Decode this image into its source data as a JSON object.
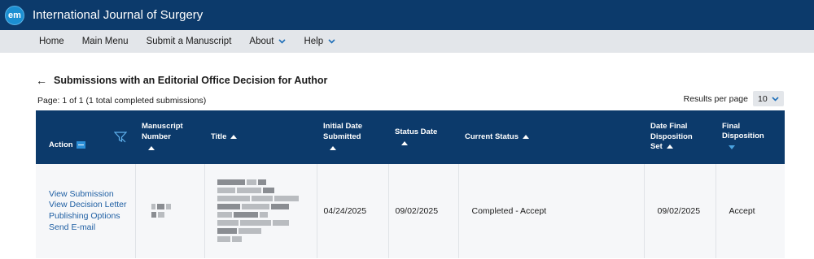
{
  "app": {
    "logo": "em",
    "journal_title": "International Journal of Surgery"
  },
  "nav": {
    "items": [
      {
        "label": "Home",
        "dropdown": false
      },
      {
        "label": "Main Menu",
        "dropdown": false
      },
      {
        "label": "Submit a Manuscript",
        "dropdown": false
      },
      {
        "label": "About",
        "dropdown": true
      },
      {
        "label": "Help",
        "dropdown": true
      }
    ]
  },
  "page": {
    "title": "Submissions with an Editorial Office Decision for Author",
    "page_info": "Page: 1 of 1 (1 total completed submissions)",
    "results_per_page_label": "Results per page",
    "results_per_page_value": "10"
  },
  "table": {
    "headers": {
      "action": "Action",
      "manuscript_number_1": "Manuscript",
      "manuscript_number_2": "Number",
      "title": "Title",
      "initial_date_1": "Initial Date",
      "initial_date_2": "Submitted",
      "status_date": "Status Date",
      "current_status": "Current Status",
      "date_final_1": "Date Final",
      "date_final_2": "Disposition",
      "date_final_3": "Set",
      "final_disposition_1": "Final",
      "final_disposition_2": "Disposition"
    },
    "rows": [
      {
        "actions": [
          "View Submission",
          "View Decision Letter",
          "Publishing Options",
          "Send E-mail"
        ],
        "initial_date_submitted": "04/24/2025",
        "status_date": "09/02/2025",
        "current_status": "Completed - Accept",
        "date_final_disposition_set": "09/02/2025",
        "final_disposition": "Accept"
      }
    ]
  },
  "colors": {
    "header_bg": "#0c3a6b",
    "nav_bg": "#e3e6ea",
    "link": "#1f5fa3",
    "accent": "#2b8fd8"
  }
}
